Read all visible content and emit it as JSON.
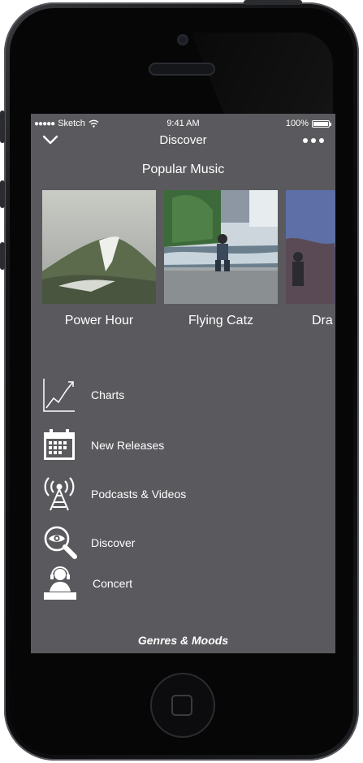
{
  "status_bar": {
    "carrier": "Sketch",
    "time": "9:41 AM",
    "battery": "100%"
  },
  "nav": {
    "title": "Discover"
  },
  "popular": {
    "title": "Popular Music",
    "albums": [
      {
        "title": "Power Hour"
      },
      {
        "title": "Flying Catz"
      },
      {
        "title": "Dra"
      }
    ]
  },
  "menu": [
    {
      "label": "Charts",
      "icon": "chart-icon"
    },
    {
      "label": "New Releases",
      "icon": "calendar-icon"
    },
    {
      "label": "Podcasts & Videos",
      "icon": "antenna-icon"
    },
    {
      "label": "Discover",
      "icon": "magnifier-eye-icon"
    },
    {
      "label": "Concert",
      "icon": "performer-icon"
    }
  ],
  "footer": {
    "label": "Genres & Moods"
  },
  "colors": {
    "screen_bg": "#5a5a5e",
    "text": "#ffffff",
    "device": "#0b0b0d"
  }
}
